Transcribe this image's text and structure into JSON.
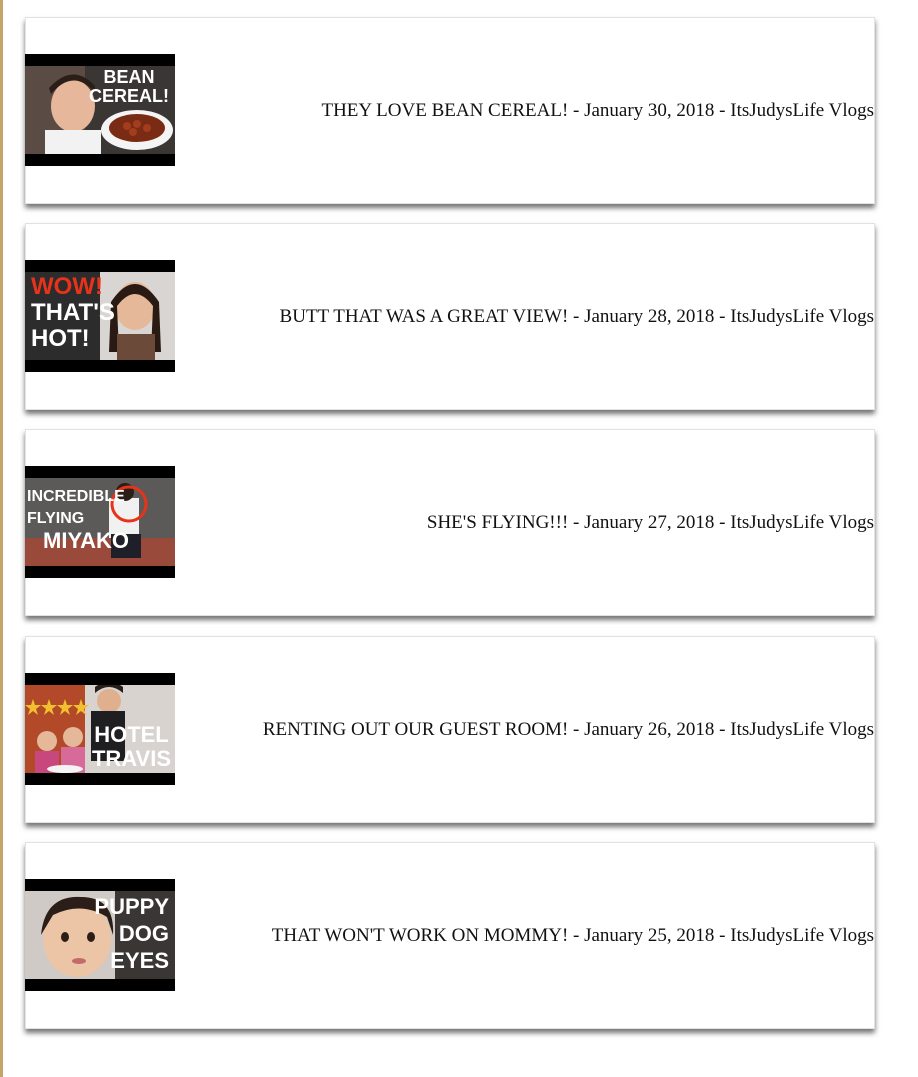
{
  "videos": [
    {
      "caption": "THEY LOVE BEAN CEREAL! - January 30, 2018 - ItsJudysLife Vlogs",
      "thumb_lines": [
        "BEAN",
        "CEREAL!"
      ]
    },
    {
      "caption": "BUTT THAT WAS A GREAT VIEW! - January 28, 2018 - ItsJudysLife Vlogs",
      "thumb_lines": [
        "WOW!",
        "THAT'S",
        "HOT!"
      ]
    },
    {
      "caption": "SHE'S FLYING!!! - January 27, 2018 - ItsJudysLife Vlogs",
      "thumb_lines": [
        "INCREDIBLE",
        "FLYING",
        "MIYAKO"
      ]
    },
    {
      "caption": "RENTING OUT OUR GUEST ROOM! - January 26, 2018 - ItsJudysLife Vlogs",
      "thumb_lines": [
        "HOTEL",
        "TRAVIS"
      ]
    },
    {
      "caption": "THAT WON'T WORK ON MOMMY! - January 25, 2018 - ItsJudysLife Vlogs",
      "thumb_lines": [
        "PUPPY",
        "DOG",
        "EYES"
      ]
    }
  ],
  "colors": {
    "rule": "#c6a467",
    "accent_red": "#e8321a"
  }
}
